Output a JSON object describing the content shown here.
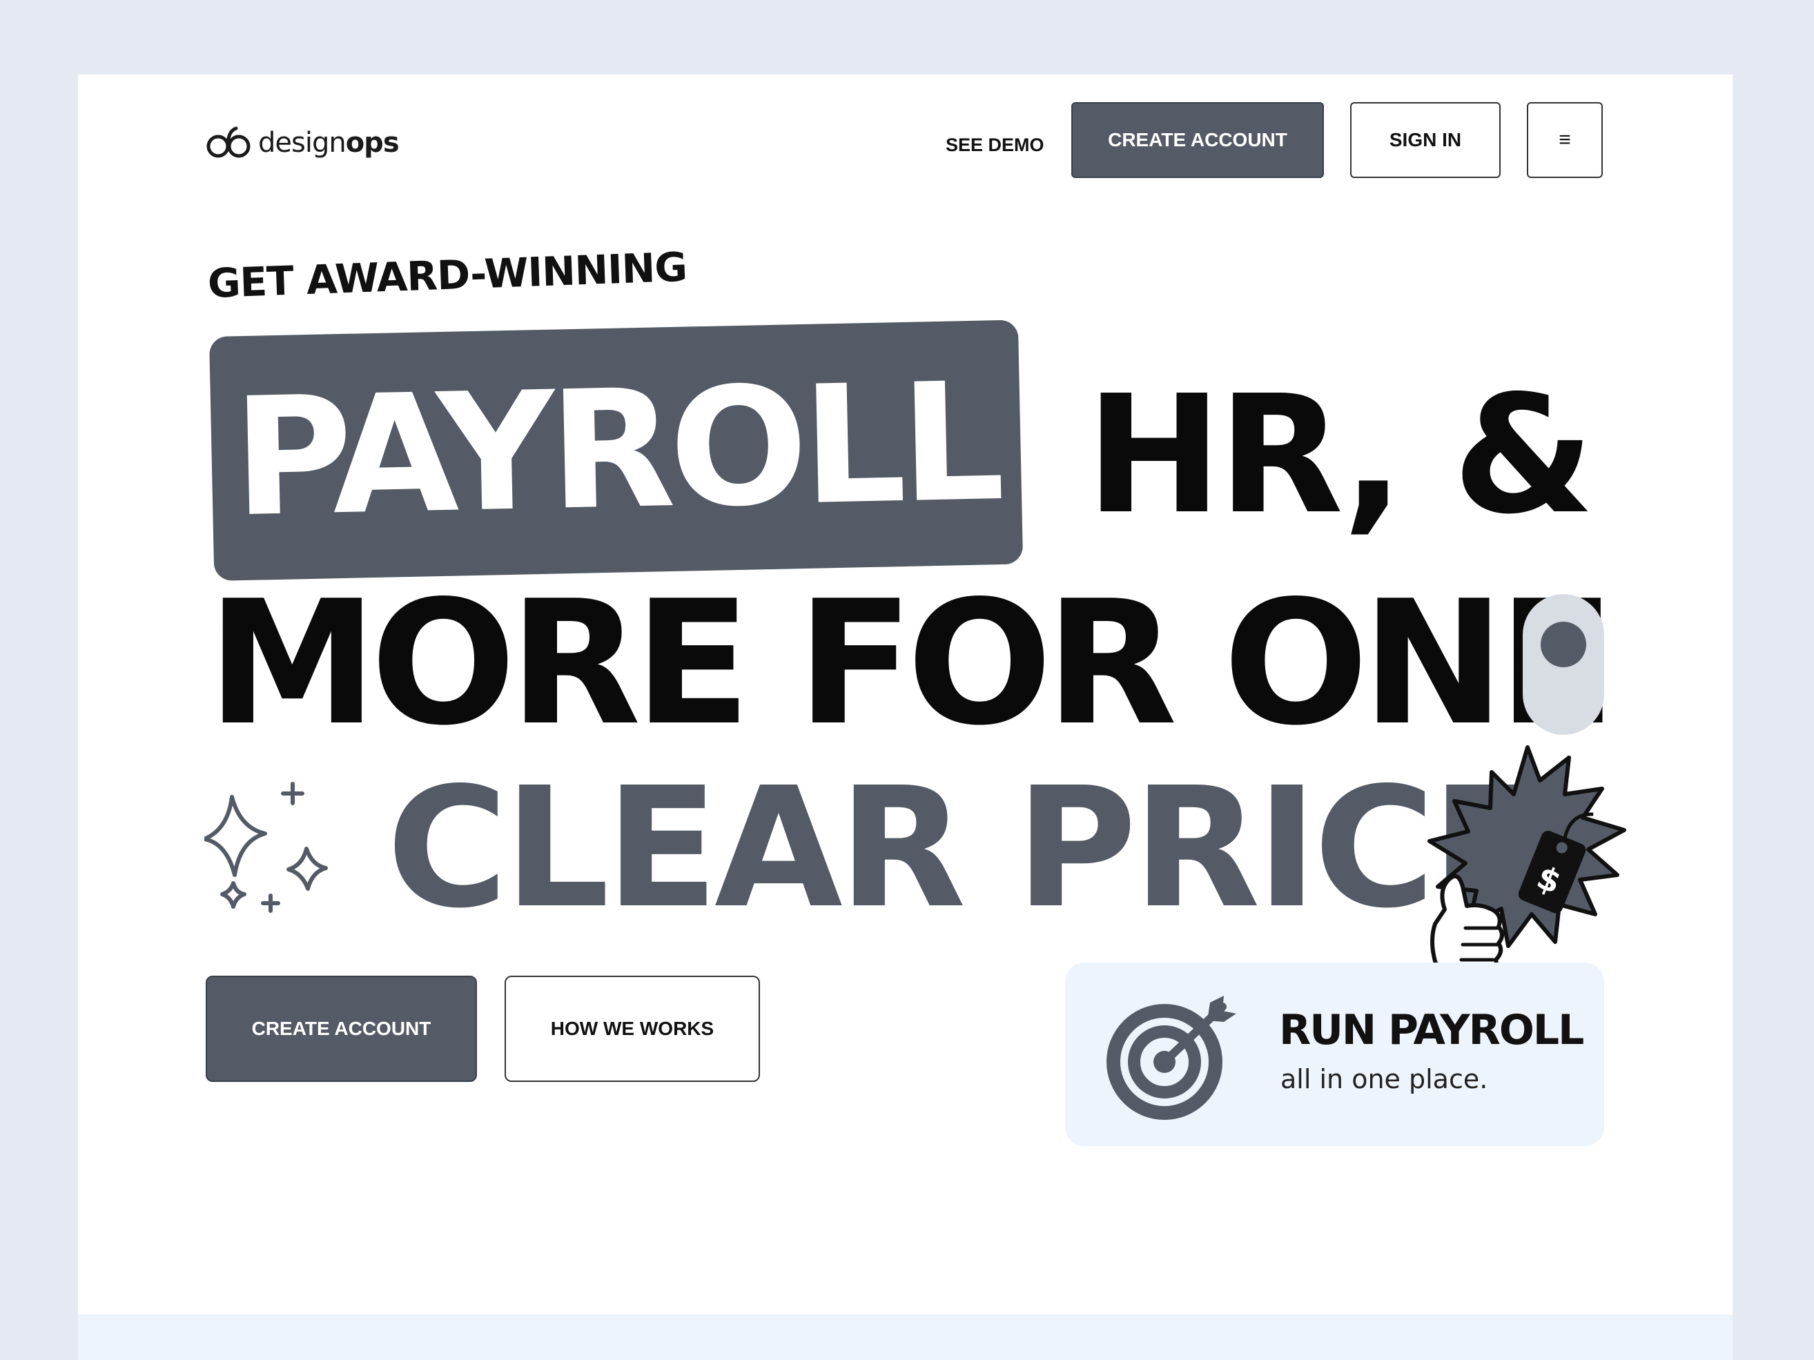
{
  "brand": {
    "logo_text_regular": "design",
    "logo_text_bold": "ops"
  },
  "nav": {
    "see_demo": "SEE DEMO",
    "create_account": "CREATE ACCOUNT",
    "sign_in": "SIGN IN",
    "menu_icon": "≡"
  },
  "hero": {
    "eyebrow": "GET AWARD-WINNING",
    "highlight_word": "PAYROLL",
    "line1_rest": "HR, &",
    "line2": "MORE FOR ONE",
    "line3": "CLEAR PRICE",
    "price_tag_symbol": "$",
    "toggle_state": "on"
  },
  "cta": {
    "create_account": "CREATE ACCOUNT",
    "how_we_works": "HOW WE WORKS"
  },
  "feature": {
    "title": "RUN PAYROLL",
    "subtitle": "all in one place.",
    "icon": "target-icon"
  },
  "colors": {
    "accent": "#545b66",
    "page_bg": "#e5eaf2",
    "card_bg": "#ffffff",
    "feature_bg": "#eef4fc",
    "toggle_track": "#d8dce3"
  }
}
